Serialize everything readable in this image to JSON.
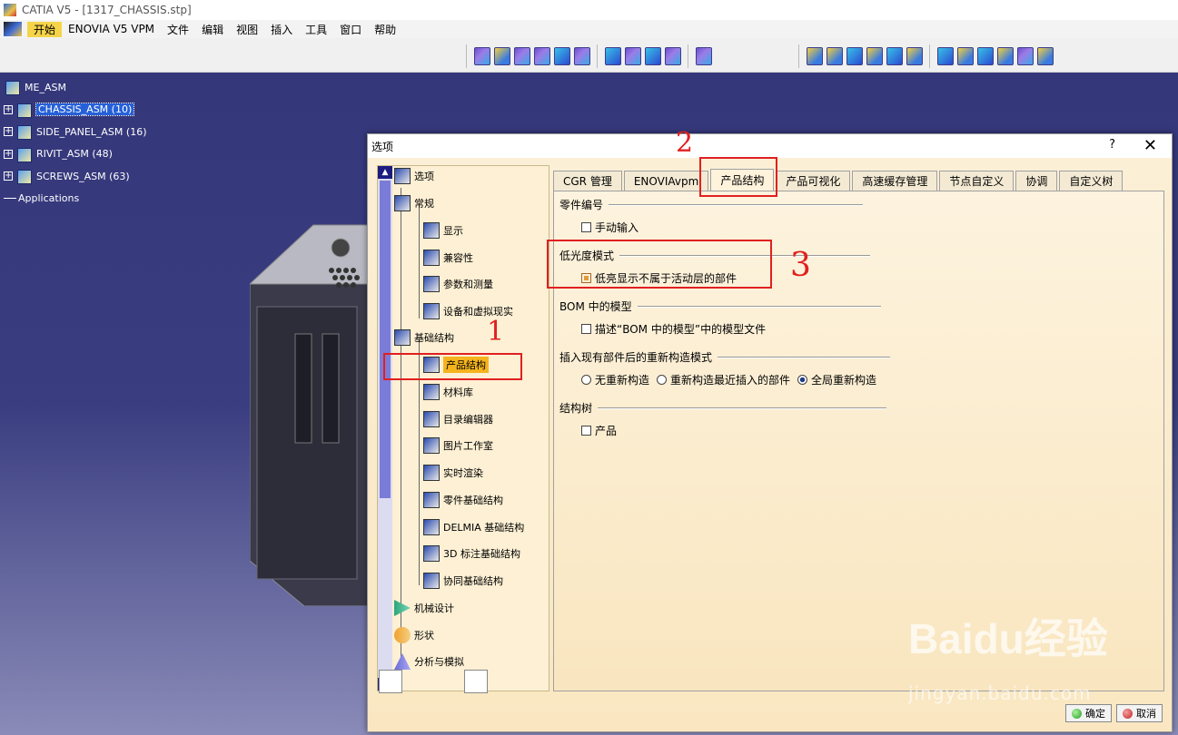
{
  "app": {
    "title": "CATIA V5 - [1317_CHASSIS.stp]"
  },
  "menu": {
    "items": [
      "开始",
      "ENOVIA V5 VPM",
      "文件",
      "编辑",
      "视图",
      "插入",
      "工具",
      "窗口",
      "帮助"
    ]
  },
  "spec_tree": {
    "root": "ME_ASM",
    "children": [
      "CHASSIS_ASM (10)",
      "SIDE_PANEL_ASM (16)",
      "RIVIT_ASM (48)",
      "SCREWS_ASM (63)"
    ],
    "applications": "Applications"
  },
  "dialog": {
    "title": "选项",
    "help": "?",
    "close": "✕",
    "nav": {
      "root": "选项",
      "general": "常规",
      "general_children": [
        "显示",
        "兼容性",
        "参数和测量",
        "设备和虚拟现实"
      ],
      "infra": "基础结构",
      "infra_children": [
        "产品结构",
        "材料库",
        "目录编辑器",
        "图片工作室",
        "实时渲染",
        "零件基础结构",
        "DELMIA 基础结构",
        "3D 标注基础结构",
        "协同基础结构"
      ],
      "mech": "机械设计",
      "shape": "形状",
      "analysis": "分析与模拟"
    },
    "tabs": [
      "CGR 管理",
      "ENOVIAvpm",
      "产品结构",
      "产品可视化",
      "高速缓存管理",
      "节点自定义",
      "协调",
      "自定义树"
    ],
    "active_tab": "产品结构",
    "groups": {
      "part_number": {
        "title": "零件编号",
        "option": "手动输入",
        "checked": false
      },
      "low_light": {
        "title": "低光度模式",
        "option": "低亮显示不属于活动层的部件",
        "checked": true
      },
      "bom": {
        "title": "BOM 中的模型",
        "option": "描述“BOM 中的模型”中的模型文件",
        "checked": false
      },
      "rebuild": {
        "title": "插入现有部件后的重新构造模式",
        "options": [
          "无重新构造",
          "重新构造最近插入的部件",
          "全局重新构造"
        ],
        "selected": "全局重新构造"
      },
      "tree": {
        "title": "结构树",
        "option": "产品",
        "checked": false
      }
    },
    "ok": "确定",
    "cancel": "取消"
  },
  "annotations": {
    "n1": "1",
    "n2": "2",
    "n3": "3"
  },
  "watermark": {
    "main": "Baidu经验",
    "sub": "jingyan.baidu.com"
  }
}
